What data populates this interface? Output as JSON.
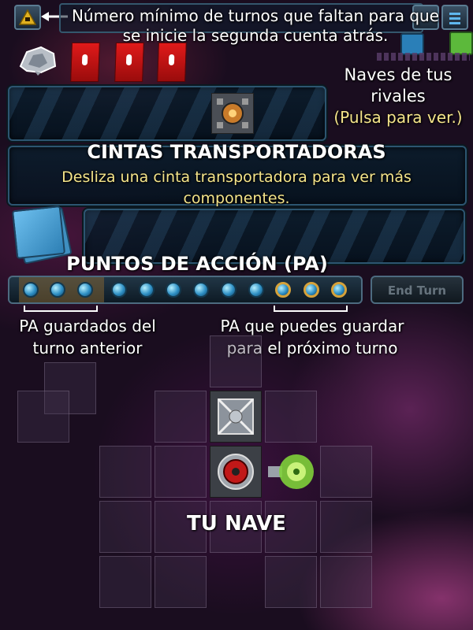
{
  "hint_top": "Número mínimo de turnos que faltan para que se inicie la segunda cuenta atrás.",
  "rivals_label": "Naves de tus rivales",
  "rivals_hint": "(Pulsa para ver.)",
  "conveyor_title": "CINTAS TRANSPORTADORAS",
  "conveyor_hint": "Desliza una cinta transportadora para ver más componentes.",
  "action_points_title": "PUNTOS DE ACCIÓN (PA)",
  "end_turn": "End Turn",
  "pa_saved": "PA guardados del turno anterior",
  "pa_can_save": "PA que puedes guardar para el próximo turno",
  "your_ship": "TU NAVE",
  "action_points": {
    "saved_previous": 3,
    "regular": 6,
    "saveable": 3
  },
  "colors": {
    "hint_yellow": "#f4e48a",
    "accent_blue": "#5fb7ee",
    "card_red": "#d21515",
    "gold_ring": "#d6a23a"
  },
  "icons": [
    "countdown-triangle-icon",
    "menu-icon",
    "crystal-rock-icon",
    "rival-ship-icon",
    "deck-icon",
    "engine-component-icon",
    "weapon-component-icon",
    "shield-component-icon"
  ]
}
